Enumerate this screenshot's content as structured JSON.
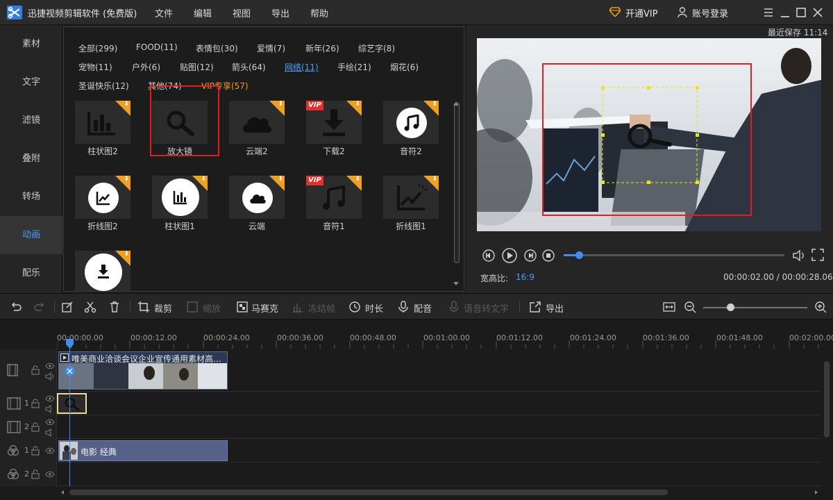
{
  "app": {
    "title": "迅捷视频剪辑软件 (免费版)",
    "menu": [
      "文件",
      "编辑",
      "视图",
      "导出",
      "帮助"
    ],
    "vip_button": "开通VIP",
    "account_button": "账号登录"
  },
  "sidebar": {
    "items": [
      {
        "label": "素材"
      },
      {
        "label": "文字"
      },
      {
        "label": "滤镜"
      },
      {
        "label": "叠附"
      },
      {
        "label": "转场"
      },
      {
        "label": "动画",
        "active": true
      },
      {
        "label": "配乐"
      }
    ]
  },
  "library": {
    "categories": [
      "全部(299)",
      "FOOD(11)",
      "表情包(30)",
      "爱情(7)",
      "新年(26)",
      "综艺字(8)",
      "宠物(11)",
      "户外(6)",
      "贴图(12)",
      "箭头(64)",
      "网络(11)",
      "手绘(21)",
      "烟花(6)",
      "圣诞快乐(12)",
      "其他(74)",
      "VIP专享(57)"
    ],
    "active_category": "网络(11)",
    "items": [
      {
        "label": "柱状图2",
        "icon": "bar-chart-icon"
      },
      {
        "label": "放大镜",
        "icon": "magnifier-icon"
      },
      {
        "label": "云端2",
        "icon": "cloud-icon"
      },
      {
        "label": "下载2",
        "icon": "download-icon",
        "badge": "VIP"
      },
      {
        "label": "音符2",
        "icon": "music-note-icon"
      },
      {
        "label": "折线图2",
        "icon": "line-chart-icon"
      },
      {
        "label": "柱状图1",
        "icon": "bar-chart-icon"
      },
      {
        "label": "云端",
        "icon": "cloud-icon"
      },
      {
        "label": "音符1",
        "icon": "music-note-icon",
        "badge": "VIP"
      },
      {
        "label": "折线图1",
        "icon": "line-chart-icon"
      },
      {
        "label": "",
        "icon": "download-icon"
      }
    ]
  },
  "preview": {
    "last_saved": "最近保存 11:14",
    "aspect_label": "宽高比:",
    "aspect_value": "16:9",
    "time_display": "00:00:02.00 / 00:00:28.06",
    "progress": 0.07
  },
  "toolbar": {
    "crop": "裁剪",
    "zoom": "缩放",
    "mosaic": "马赛克",
    "freeze": "冻结帧",
    "duration": "时长",
    "voiceover": "配音",
    "speech_to_text": "语音转文字",
    "export": "导出"
  },
  "timeline": {
    "ruler": [
      "00:00:00.00",
      "00:00:12.00",
      "00:00:24.00",
      "00:00:36.00",
      "00:00:48.00",
      "00:01:00.00",
      "00:01:12.00",
      "00:01:24.00",
      "00:01:36.00",
      "00:01:48.00",
      "00:02:00.00"
    ],
    "video_clip_title": "唯美商业洽谈会议企业宣传通用素材高…",
    "track_numbers": {
      "anim1": "1",
      "anim2": "2",
      "filter1": "1",
      "filter2": "2"
    },
    "filter_clip_title": "电影 经典"
  },
  "colors": {
    "accent": "#3d8ef0",
    "vip": "#f0a020",
    "highlight": "#e02020"
  }
}
